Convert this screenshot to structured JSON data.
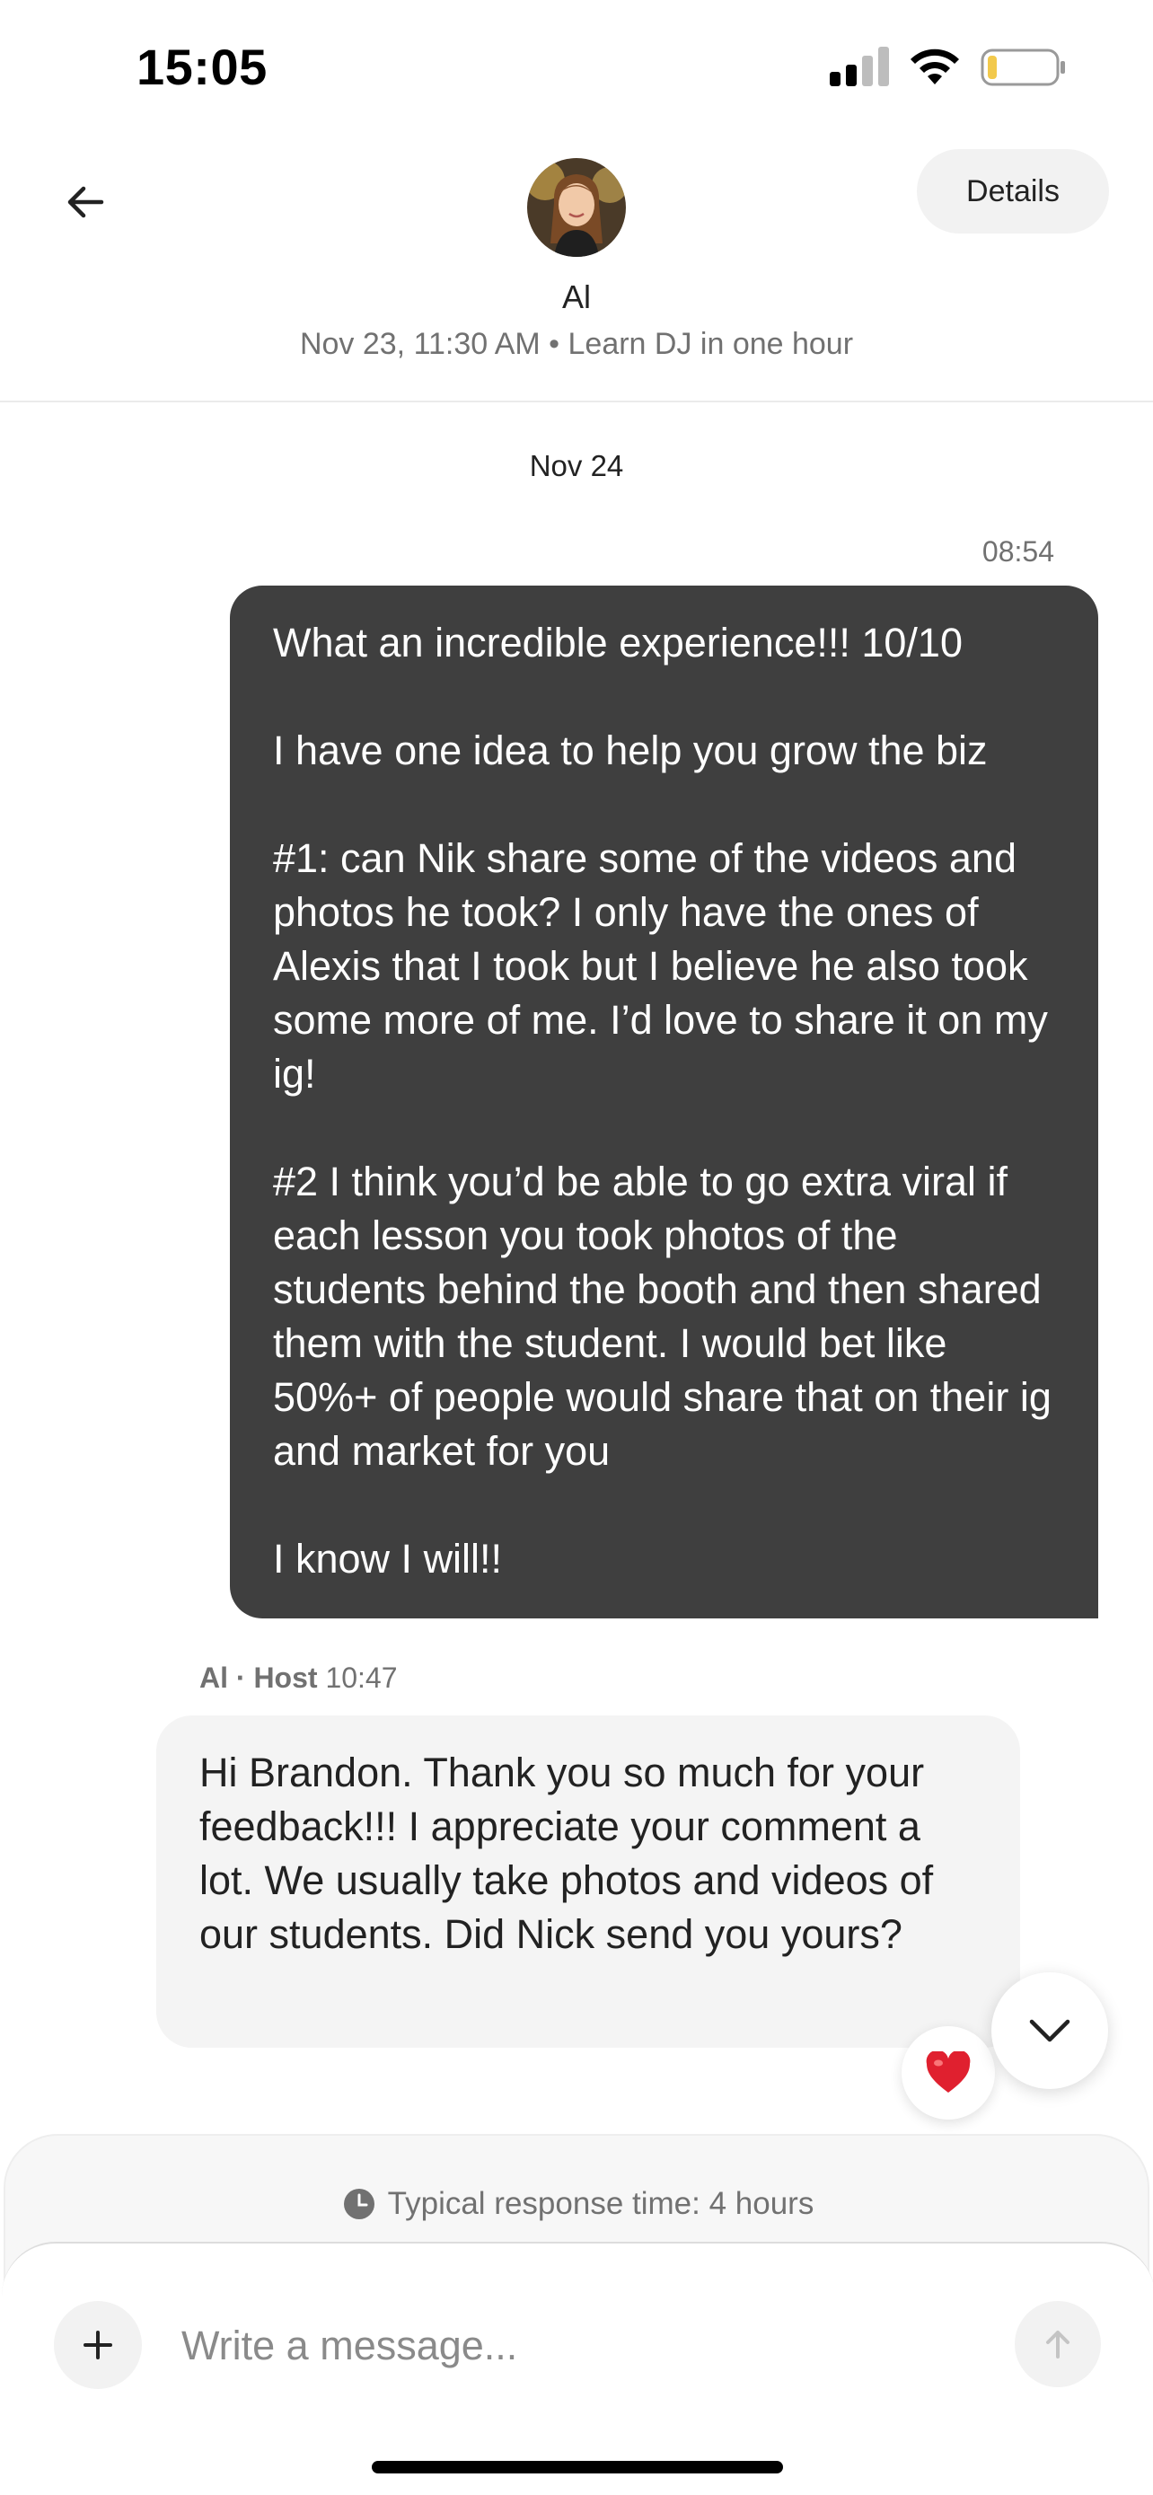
{
  "status_bar": {
    "time": "15:05",
    "icons": [
      "signal-icon",
      "wifi-icon",
      "battery-icon"
    ]
  },
  "header": {
    "back_icon": "arrow-left-icon",
    "avatar_alt": "avatar",
    "host_name": "Al",
    "subtitle": "Nov 23, 11:30 AM • Learn DJ in one hour",
    "details_label": "Details"
  },
  "chat": {
    "date_divider": "Nov 24",
    "sent_message": {
      "time": "08:54",
      "text": "What an incredible experience!!! 10/10\n\nI have one idea to help you grow the biz\n\n#1: can Nik share some of the videos and photos he took? I only have the ones of Alexis that I took but I believe he also took some more of me. I’d love to share it on my ig!\n\n#2 I think you’d be able to go extra viral if each lesson you took photos of the students behind the booth and then shared them with the student. I would bet like 50%+ of people would share that on their ig and market for you\n\nI know I will!!"
    },
    "received_message": {
      "sender": "Al · Host",
      "time": "10:47",
      "text": "Hi Brandon. Thank you so much for your feedback!!! I appreciate your comment a lot. We usually take photos and videos of our students. Did Nick send you yours?",
      "reaction_icon": "heart-icon"
    },
    "scroll_down_icon": "chevron-down-icon"
  },
  "composer": {
    "response_time": "Typical response time: 4 hours",
    "placeholder": "Write a message...",
    "value": "",
    "plus_icon": "plus-icon",
    "send_icon": "arrow-up-icon"
  },
  "colors": {
    "sent_bubble": "#3f3f3f",
    "received_bubble": "#f4f4f4",
    "secondary_text": "#717171",
    "heart": "#e0202f"
  }
}
